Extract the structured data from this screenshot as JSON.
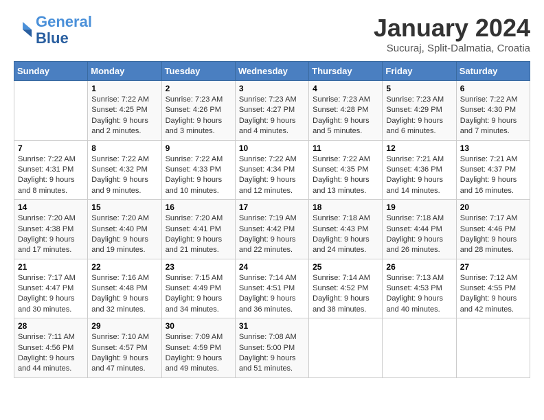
{
  "header": {
    "logo_line1": "General",
    "logo_line2": "Blue",
    "month": "January 2024",
    "location": "Sucuraj, Split-Dalmatia, Croatia"
  },
  "weekdays": [
    "Sunday",
    "Monday",
    "Tuesday",
    "Wednesday",
    "Thursday",
    "Friday",
    "Saturday"
  ],
  "weeks": [
    [
      {
        "day": "",
        "info": ""
      },
      {
        "day": "1",
        "info": "Sunrise: 7:22 AM\nSunset: 4:25 PM\nDaylight: 9 hours\nand 2 minutes."
      },
      {
        "day": "2",
        "info": "Sunrise: 7:23 AM\nSunset: 4:26 PM\nDaylight: 9 hours\nand 3 minutes."
      },
      {
        "day": "3",
        "info": "Sunrise: 7:23 AM\nSunset: 4:27 PM\nDaylight: 9 hours\nand 4 minutes."
      },
      {
        "day": "4",
        "info": "Sunrise: 7:23 AM\nSunset: 4:28 PM\nDaylight: 9 hours\nand 5 minutes."
      },
      {
        "day": "5",
        "info": "Sunrise: 7:23 AM\nSunset: 4:29 PM\nDaylight: 9 hours\nand 6 minutes."
      },
      {
        "day": "6",
        "info": "Sunrise: 7:22 AM\nSunset: 4:30 PM\nDaylight: 9 hours\nand 7 minutes."
      }
    ],
    [
      {
        "day": "7",
        "info": "Sunrise: 7:22 AM\nSunset: 4:31 PM\nDaylight: 9 hours\nand 8 minutes."
      },
      {
        "day": "8",
        "info": "Sunrise: 7:22 AM\nSunset: 4:32 PM\nDaylight: 9 hours\nand 9 minutes."
      },
      {
        "day": "9",
        "info": "Sunrise: 7:22 AM\nSunset: 4:33 PM\nDaylight: 9 hours\nand 10 minutes."
      },
      {
        "day": "10",
        "info": "Sunrise: 7:22 AM\nSunset: 4:34 PM\nDaylight: 9 hours\nand 12 minutes."
      },
      {
        "day": "11",
        "info": "Sunrise: 7:22 AM\nSunset: 4:35 PM\nDaylight: 9 hours\nand 13 minutes."
      },
      {
        "day": "12",
        "info": "Sunrise: 7:21 AM\nSunset: 4:36 PM\nDaylight: 9 hours\nand 14 minutes."
      },
      {
        "day": "13",
        "info": "Sunrise: 7:21 AM\nSunset: 4:37 PM\nDaylight: 9 hours\nand 16 minutes."
      }
    ],
    [
      {
        "day": "14",
        "info": "Sunrise: 7:20 AM\nSunset: 4:38 PM\nDaylight: 9 hours\nand 17 minutes."
      },
      {
        "day": "15",
        "info": "Sunrise: 7:20 AM\nSunset: 4:40 PM\nDaylight: 9 hours\nand 19 minutes."
      },
      {
        "day": "16",
        "info": "Sunrise: 7:20 AM\nSunset: 4:41 PM\nDaylight: 9 hours\nand 21 minutes."
      },
      {
        "day": "17",
        "info": "Sunrise: 7:19 AM\nSunset: 4:42 PM\nDaylight: 9 hours\nand 22 minutes."
      },
      {
        "day": "18",
        "info": "Sunrise: 7:18 AM\nSunset: 4:43 PM\nDaylight: 9 hours\nand 24 minutes."
      },
      {
        "day": "19",
        "info": "Sunrise: 7:18 AM\nSunset: 4:44 PM\nDaylight: 9 hours\nand 26 minutes."
      },
      {
        "day": "20",
        "info": "Sunrise: 7:17 AM\nSunset: 4:46 PM\nDaylight: 9 hours\nand 28 minutes."
      }
    ],
    [
      {
        "day": "21",
        "info": "Sunrise: 7:17 AM\nSunset: 4:47 PM\nDaylight: 9 hours\nand 30 minutes."
      },
      {
        "day": "22",
        "info": "Sunrise: 7:16 AM\nSunset: 4:48 PM\nDaylight: 9 hours\nand 32 minutes."
      },
      {
        "day": "23",
        "info": "Sunrise: 7:15 AM\nSunset: 4:49 PM\nDaylight: 9 hours\nand 34 minutes."
      },
      {
        "day": "24",
        "info": "Sunrise: 7:14 AM\nSunset: 4:51 PM\nDaylight: 9 hours\nand 36 minutes."
      },
      {
        "day": "25",
        "info": "Sunrise: 7:14 AM\nSunset: 4:52 PM\nDaylight: 9 hours\nand 38 minutes."
      },
      {
        "day": "26",
        "info": "Sunrise: 7:13 AM\nSunset: 4:53 PM\nDaylight: 9 hours\nand 40 minutes."
      },
      {
        "day": "27",
        "info": "Sunrise: 7:12 AM\nSunset: 4:55 PM\nDaylight: 9 hours\nand 42 minutes."
      }
    ],
    [
      {
        "day": "28",
        "info": "Sunrise: 7:11 AM\nSunset: 4:56 PM\nDaylight: 9 hours\nand 44 minutes."
      },
      {
        "day": "29",
        "info": "Sunrise: 7:10 AM\nSunset: 4:57 PM\nDaylight: 9 hours\nand 47 minutes."
      },
      {
        "day": "30",
        "info": "Sunrise: 7:09 AM\nSunset: 4:59 PM\nDaylight: 9 hours\nand 49 minutes."
      },
      {
        "day": "31",
        "info": "Sunrise: 7:08 AM\nSunset: 5:00 PM\nDaylight: 9 hours\nand 51 minutes."
      },
      {
        "day": "",
        "info": ""
      },
      {
        "day": "",
        "info": ""
      },
      {
        "day": "",
        "info": ""
      }
    ]
  ]
}
